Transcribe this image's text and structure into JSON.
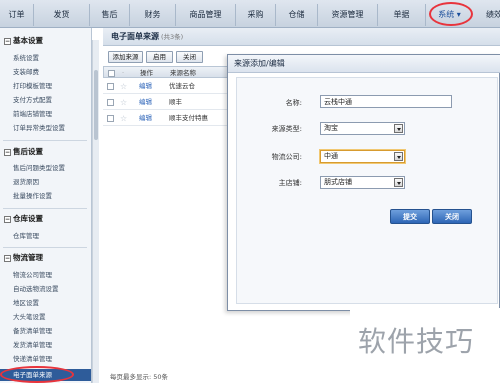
{
  "top_nav": {
    "tabs": [
      {
        "label": "订单"
      },
      {
        "label": "发货"
      },
      {
        "label": "售后"
      },
      {
        "label": "财务"
      },
      {
        "label": "商品管理"
      },
      {
        "label": "采购"
      },
      {
        "label": "仓储"
      },
      {
        "label": "资源管理"
      },
      {
        "label": "单据"
      },
      {
        "label": "系统 ▾"
      },
      {
        "label": "绩效"
      }
    ]
  },
  "sidebar": {
    "sections": [
      {
        "title": "基本设置",
        "toggle": "−",
        "items": [
          "系统设置",
          "支装邮费",
          "打印模板管理",
          "支付方式配置",
          "前端店铺管理",
          "订单异常类型设置"
        ]
      },
      {
        "title": "售后设置",
        "toggle": "−",
        "items": [
          "售后问题类型设置",
          "退货原因",
          "批量操作设置"
        ]
      },
      {
        "title": "仓库设置",
        "toggle": "−",
        "items": [
          "仓库管理"
        ]
      },
      {
        "title": "物流管理",
        "toggle": "−",
        "items": [
          "物流公司管理",
          "自动选物流设置",
          "地区设置",
          "大头笔设置",
          "备货清单管理",
          "发货清单管理",
          "快递清单管理",
          "电子面单来源"
        ]
      }
    ],
    "active_item": "电子面单来源"
  },
  "main": {
    "title": "电子面单来源",
    "count_text": "(共3条)",
    "toolbar": {
      "add": "添加来源",
      "enable": "启用",
      "disable": "关闭"
    },
    "grid": {
      "headers": {
        "select": "",
        "star": "",
        "action": "操作",
        "name": "来源名称"
      },
      "rows": [
        {
          "action": "编辑",
          "name": "优速云仓"
        },
        {
          "action": "编辑",
          "name": "顺丰"
        },
        {
          "action": "编辑",
          "name": "顺丰支付特惠"
        }
      ]
    },
    "footer": "每页最多显示:  50条"
  },
  "modal": {
    "title": "来源添加/编辑",
    "fields": {
      "name_label": "名称:",
      "name_value": "云栈中通",
      "source_type_label": "来源类型:",
      "source_type_value": "淘宝",
      "logistics_label": "物流公司:",
      "logistics_value": "中通",
      "shop_label": "主店铺:",
      "shop_value": "朋式店铺"
    },
    "submit": "提交",
    "close": "关闭"
  },
  "watermark": "软件技巧",
  "colors": {
    "highlight_circle": "#e8343c",
    "active_item_bg": "#2e5c9a",
    "link": "#2b63b8"
  }
}
